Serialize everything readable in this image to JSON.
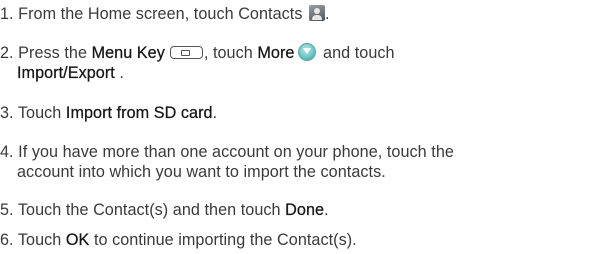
{
  "steps": [
    {
      "num": "1.",
      "before": "From the Home screen, touch Contacts",
      "icon": "contacts-icon",
      "after": "."
    },
    {
      "num": "2.",
      "t1": "Press the",
      "k1": "Menu Key",
      "icon1": "menu-key-icon",
      "t2": ", touch",
      "k2": "More",
      "icon2": "more-arrow-icon",
      "t3": "and touch",
      "k3": "Import/Export",
      "t4": "."
    },
    {
      "num": "3.",
      "t1": "Touch",
      "k1": "Import from SD card",
      "t2": "."
    },
    {
      "num": "4.",
      "line1": "If you have more than one account on your phone, touch the",
      "line2": "account into which you want to import the contacts."
    },
    {
      "num": "5.",
      "t1": "Touch the Contact(s) and then touch",
      "k1": "Done",
      "t2": "."
    },
    {
      "num": "6.",
      "t1": "Touch",
      "k1": "OK",
      "t2": "to continue importing the Contact(s)."
    }
  ]
}
